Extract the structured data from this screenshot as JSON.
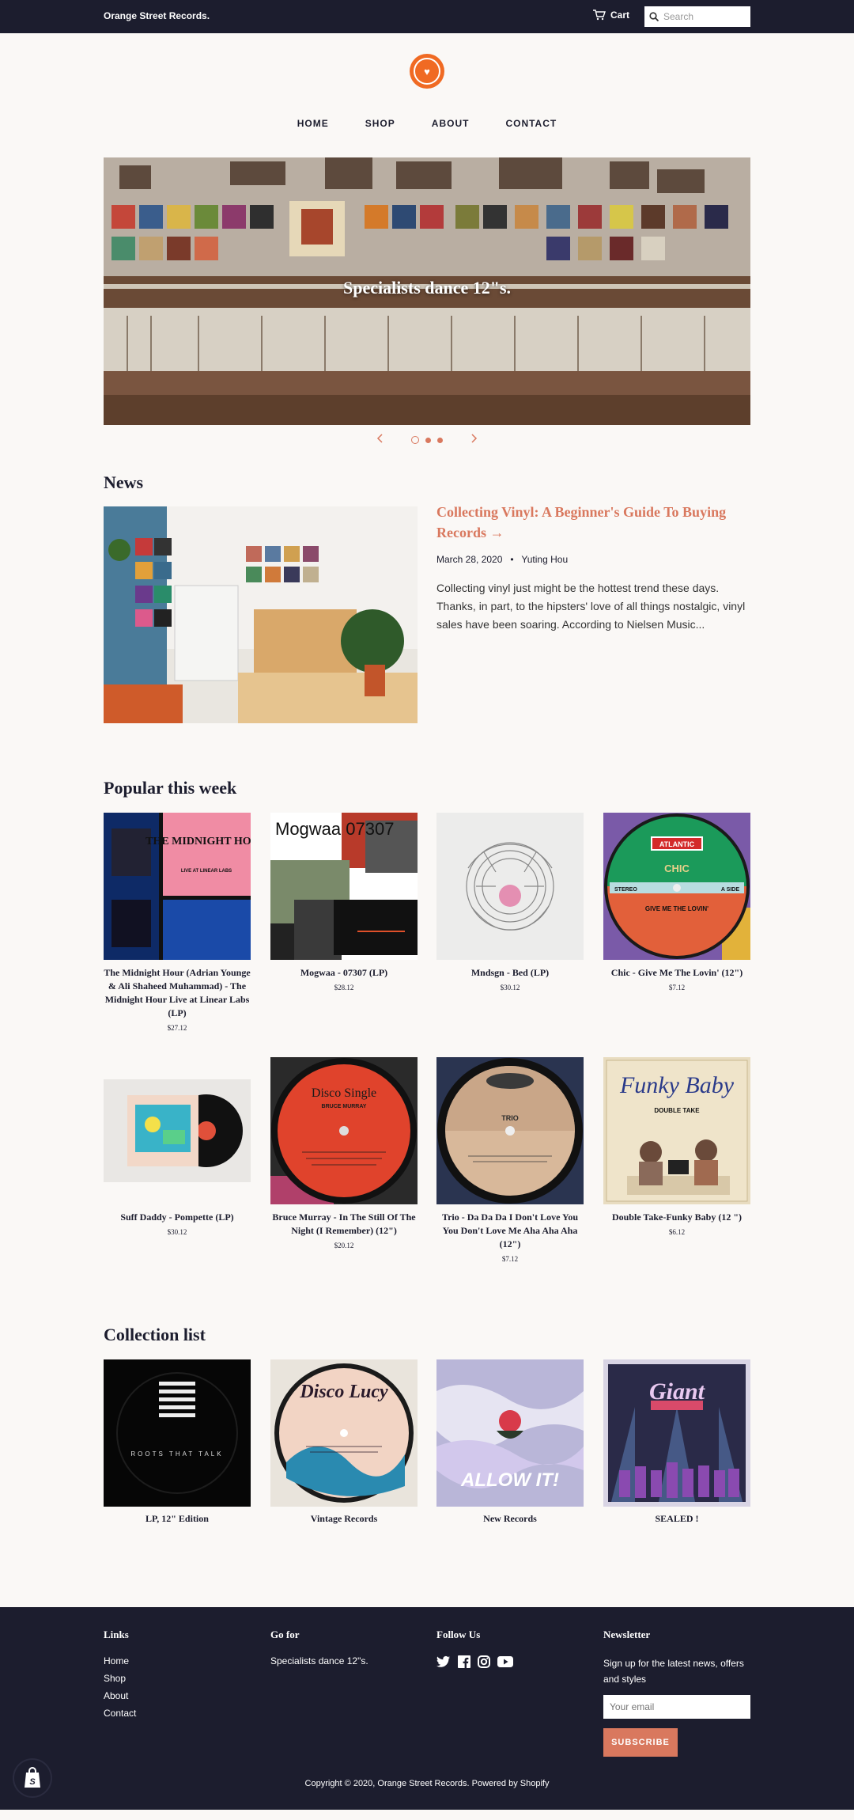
{
  "header": {
    "shop_name": "Orange Street Records.",
    "cart_label": "Cart",
    "search_placeholder": "Search"
  },
  "nav": [
    "HOME",
    "SHOP",
    "ABOUT",
    "CONTACT"
  ],
  "slideshow": {
    "caption": "Specialists dance 12\"s.",
    "slide_count": 3,
    "active_slide": 1
  },
  "news": {
    "heading": "News",
    "article_title": "Collecting Vinyl: A Beginner's Guide To Buying Records →",
    "date": "March 28, 2020",
    "author": "Yuting Hou",
    "excerpt": "Collecting vinyl just might be the hottest trend these days. Thanks, in part, to the hipsters' love of all things nostalgic, vinyl sales have been soaring. According to Nielsen Music..."
  },
  "popular": {
    "heading": "Popular this week",
    "products": [
      {
        "title": "The Midnight Hour (Adrian Younge & Ali Shaheed Muhammad) - The Midnight Hour Live at Linear Labs (LP)",
        "price": "$27.12"
      },
      {
        "title": "Mogwaa - 07307 (LP)",
        "price": "$28.12"
      },
      {
        "title": "Mndsgn - Bed (LP)",
        "price": "$30.12"
      },
      {
        "title": "Chic - Give Me The Lovin' (12\")",
        "price": "$7.12"
      },
      {
        "title": "Suff Daddy - Pompette (LP)",
        "price": "$30.12"
      },
      {
        "title": "Bruce Murray - In The Still Of The Night (I Remember) (12\")",
        "price": "$20.12"
      },
      {
        "title": "Trio - Da Da Da I Don't Love You You Don't Love Me Aha Aha Aha (12\")",
        "price": "$7.12"
      },
      {
        "title": "Double Take-Funky Baby (12 \")",
        "price": "$6.12"
      }
    ],
    "art_text": {
      "midnight": "THE MIDNIGHT HOUR",
      "midnight_sub": "LIVE AT LINEAR LABS",
      "mogwaa": "Mogwaa 07307",
      "atlantic": "ATLANTIC",
      "chic": "CHIC",
      "stereo": "STEREO",
      "aside": "A SIDE",
      "givemelovin": "GIVE ME THE LOVIN'",
      "disco_single": "Disco Single",
      "bruce": "BRUCE MURRAY",
      "trio": "TRIO",
      "funky": "Funky Baby",
      "double_take": "DOUBLE TAKE"
    }
  },
  "collections": {
    "heading": "Collection list",
    "items": [
      {
        "title": "LP, 12\" Edition"
      },
      {
        "title": "Vintage Records"
      },
      {
        "title": "New Records"
      },
      {
        "title": "SEALED !"
      }
    ],
    "art_text": {
      "roots": "ROOTS THAT TALK",
      "disco_lucy": "Disco Lucy",
      "allow_it": "ALLOW IT!",
      "giant": "Giant"
    }
  },
  "footer": {
    "links_heading": "Links",
    "links": [
      "Home",
      "Shop",
      "About",
      "Contact"
    ],
    "goto_heading": "Go for",
    "goto_text": "Specialists dance 12\"s.",
    "follow_heading": "Follow Us",
    "social_icons": [
      "twitter-icon",
      "facebook-icon",
      "instagram-icon",
      "youtube-icon"
    ],
    "newsletter_heading": "Newsletter",
    "newsletter_text": "Sign up for the latest news, offers and styles",
    "email_placeholder": "Your email",
    "subscribe_label": "SUBSCRIBE",
    "copyright": "Copyright © 2020, Orange Street Records. Powered by Shopify"
  },
  "colors": {
    "dark": "#1c1d2e",
    "accent": "#d9785e",
    "logo": "#f06a23",
    "background": "#faf8f6"
  }
}
